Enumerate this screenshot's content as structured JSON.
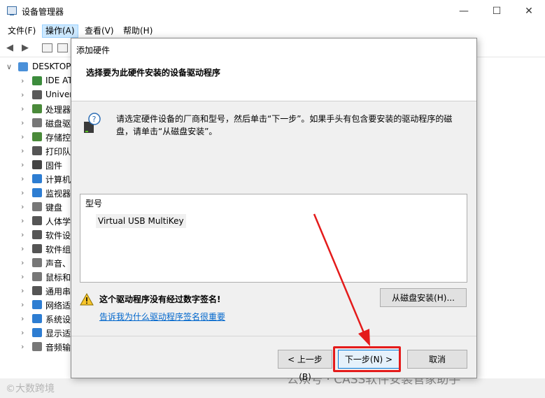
{
  "window": {
    "title": "设备管理器",
    "controls": {
      "minimize": "—",
      "maximize": "☐",
      "close": "✕"
    }
  },
  "menubar": {
    "items": [
      "文件(F)",
      "操作(A)",
      "查看(V)",
      "帮助(H)"
    ],
    "active_index": 1
  },
  "toolbar": {
    "icons": [
      "back-arrow-icon",
      "forward-arrow-icon",
      "properties-icon",
      "help-icon"
    ]
  },
  "tree": {
    "root_label": "DESKTOP",
    "items": [
      {
        "label": "IDE AT",
        "icon": "ide-controller-icon",
        "color": "#3c8c3c"
      },
      {
        "label": "Univer",
        "icon": "usb-controller-icon",
        "color": "#5a5a5a"
      },
      {
        "label": "处理器",
        "icon": "processor-icon",
        "color": "#4a8a3a"
      },
      {
        "label": "磁盘驱",
        "icon": "disk-drive-icon",
        "color": "#777777"
      },
      {
        "label": "存储控",
        "icon": "storage-controller-icon",
        "color": "#4a8a3a"
      },
      {
        "label": "打印队",
        "icon": "printer-icon",
        "color": "#555555"
      },
      {
        "label": "固件",
        "icon": "firmware-icon",
        "color": "#444444"
      },
      {
        "label": "计算机",
        "icon": "computer-icon",
        "color": "#2d7dd2"
      },
      {
        "label": "监视器",
        "icon": "monitor-icon",
        "color": "#2d7dd2"
      },
      {
        "label": "键盘",
        "icon": "keyboard-icon",
        "color": "#777777"
      },
      {
        "label": "人体学",
        "icon": "hid-icon",
        "color": "#555555"
      },
      {
        "label": "软件设",
        "icon": "software-device-icon",
        "color": "#555555"
      },
      {
        "label": "软件组",
        "icon": "software-component-icon",
        "color": "#555555"
      },
      {
        "label": "声音、",
        "icon": "speaker-icon",
        "color": "#777777"
      },
      {
        "label": "鼠标和",
        "icon": "mouse-icon",
        "color": "#777777"
      },
      {
        "label": "通用串",
        "icon": "usb-icon",
        "color": "#555555"
      },
      {
        "label": "网络适",
        "icon": "network-adapter-icon",
        "color": "#2d7dd2"
      },
      {
        "label": "系统设",
        "icon": "system-device-icon",
        "color": "#2d7dd2"
      },
      {
        "label": "显示适",
        "icon": "display-adapter-icon",
        "color": "#2d7dd2"
      },
      {
        "label": "音频输",
        "icon": "audio-io-icon",
        "color": "#777777"
      }
    ]
  },
  "dialog": {
    "title": "添加硬件",
    "heading": "选择要为此硬件安装的设备驱动程序",
    "instruction": "请选定硬件设备的厂商和型号，然后单击“下一步”。如果手头有包含要安装的驱动程序的磁盘，请单击“从磁盘安装”。",
    "model_header": "型号",
    "model_item": "Virtual USB MultiKey",
    "warning": "这个驱动程序没有经过数字签名!",
    "warning_link": "告诉我为什么驱动程序签名很重要",
    "have_disk": "从磁盘安装(H)...",
    "back": "< 上一步(B)",
    "next": "下一步(N) >",
    "cancel": "取消"
  },
  "watermarks": {
    "left": "©大数跨境",
    "right": "公众号 · CASS软件安装管家助手"
  },
  "colors": {
    "highlight": "#e41b1b",
    "link": "#0066cc",
    "active_menu": "#cce8ff"
  }
}
